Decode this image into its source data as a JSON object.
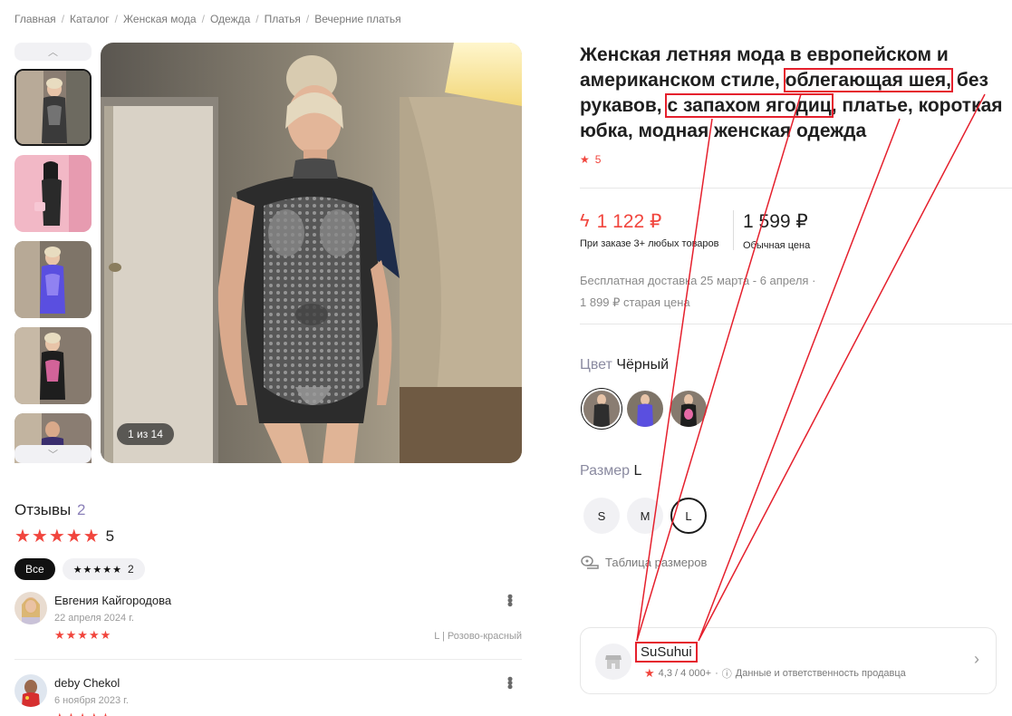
{
  "breadcrumb": [
    "Главная",
    "Каталог",
    "Женская мода",
    "Одежда",
    "Платья",
    "Вечерние платья"
  ],
  "gallery": {
    "up_icon": "chevron-up-icon",
    "down_icon": "chevron-down-icon",
    "counter": "1 из 14"
  },
  "reviews": {
    "title": "Отзывы",
    "count": "2",
    "rating": "5",
    "filter_all": "Все",
    "filter_5_count": "2",
    "items": [
      {
        "name": "Евгения Кайгородова",
        "date": "22 апреля 2024 г.",
        "stars": 5,
        "meta": "L | Розово-красный"
      },
      {
        "name": "deby Chekol",
        "date": "6 ноября 2023 г.",
        "stars": 5,
        "meta": ""
      }
    ]
  },
  "product": {
    "title_part1": "Женская летняя мода в европейском и американском стиле, ",
    "title_hl1": "облегающая шея,",
    "title_part2": " без рукавов, ",
    "title_hl2": "с запахом ягодиц",
    "title_part3": ", платье, короткая юбка, модная женская одежда",
    "rating": "5"
  },
  "price": {
    "special": "1 122 ₽",
    "special_note": "При заказе 3+ любых товаров",
    "regular": "1 599 ₽",
    "regular_note": "Обычная цена",
    "delivery": "Бесплатная доставка 25 марта - 6 апреля ·",
    "old_price": "1 899 ₽ старая цена"
  },
  "color": {
    "label": "Цвет",
    "value": "Чёрный"
  },
  "size": {
    "label": "Размер",
    "value": "L",
    "options": [
      "S",
      "M",
      "L"
    ],
    "table_link": "Таблица размеров"
  },
  "seller": {
    "name": "SuSuhui",
    "rating": "4,3 / 4 000+",
    "info_link": "Данные и ответственность продавца"
  },
  "colors": {
    "accent": "#f1453d",
    "highlight": "#e5202d",
    "dark": "#111111"
  }
}
